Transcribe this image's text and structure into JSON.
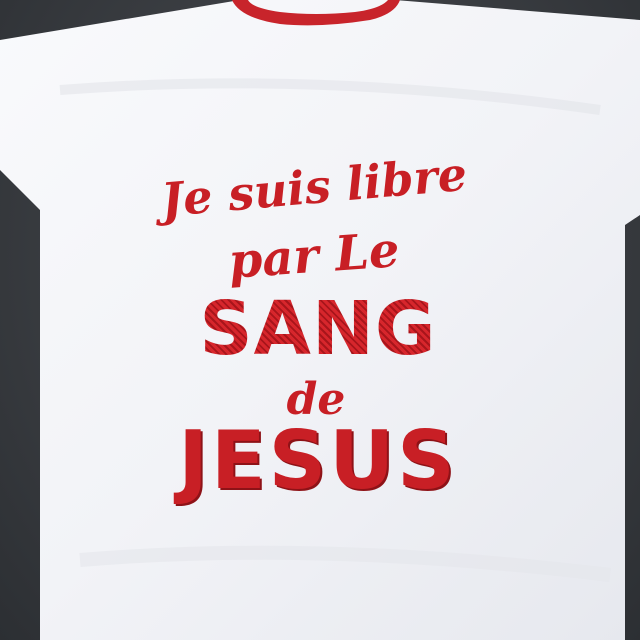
{
  "photo": {
    "subject": "t-shirt",
    "colors": {
      "shirt": "#f4f5f8",
      "collar": "#c8242b",
      "print": "#c81f25",
      "background": "#34373c"
    }
  },
  "print_text": {
    "line1": "Je suis libre",
    "line2": "par Le",
    "line3": "SANG",
    "line4": "de",
    "line5": "JESUS"
  }
}
